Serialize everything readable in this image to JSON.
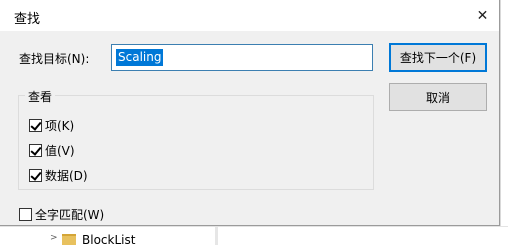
{
  "dialog": {
    "title": "查找",
    "close_label": "✕"
  },
  "find": {
    "label": "查找目标(N):",
    "value": "Scaling"
  },
  "buttons": {
    "find_next": "查找下一个(F)",
    "cancel": "取消"
  },
  "look_at": {
    "title": "查看",
    "options": [
      {
        "label": "项(K)",
        "checked": true
      },
      {
        "label": "值(V)",
        "checked": true
      },
      {
        "label": "数据(D)",
        "checked": true
      }
    ]
  },
  "match_whole": {
    "label": "全字匹配(W)",
    "checked": false
  },
  "background": {
    "tree_item": "BlockList"
  }
}
